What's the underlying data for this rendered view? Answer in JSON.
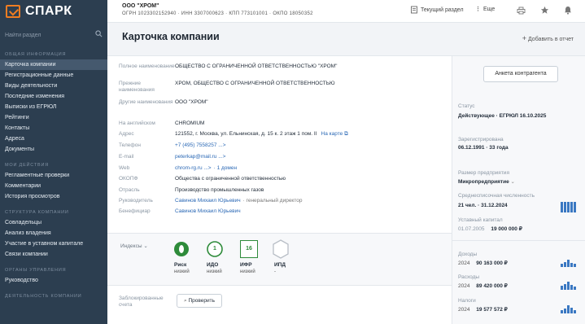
{
  "app": {
    "logo_text": "СПАРК"
  },
  "sidebar": {
    "search_placeholder": "Найти раздел",
    "sections": [
      {
        "title": "ОБЩАЯ ИНФОРМАЦИЯ",
        "items": [
          "Карточка компании",
          "Регистрационные данные",
          "Виды деятельности",
          "Последние изменения",
          "Выписки из ЕГРЮЛ",
          "Рейтинги",
          "Контакты",
          "Адреса",
          "Документы"
        ]
      },
      {
        "title": "МОИ ДЕЙСТВИЯ",
        "items": [
          "Регламентные проверки",
          "Комментарии",
          "История просмотров"
        ]
      },
      {
        "title": "СТРУКТУРА КОМПАНИИ",
        "items": [
          "Совладельцы",
          "Анализ владения",
          "Участие в уставном капитале",
          "Связи компании"
        ]
      },
      {
        "title": "ОРГАНЫ УПРАВЛЕНИЯ",
        "items": [
          "Руководство"
        ]
      },
      {
        "title": "ДЕЯТЕЛЬНОСТЬ КОМПАНИИ",
        "items": []
      }
    ]
  },
  "topbar": {
    "org_name": "ООО \"ХРОМ\"",
    "org_ids": "ОГРН 1023302152940 · ИНН 3307000623 · КПП 773101001 · ОКПО 18050352",
    "current_section": "Текущий раздел",
    "more": "Еще"
  },
  "main": {
    "title": "Карточка компании",
    "add_to_report": "Добавить в отчет",
    "fields": [
      {
        "label": "Полное наименование",
        "value": "ОБЩЕСТВО С ОГРАНИЧЕННОЙ ОТВЕТСТВЕННОСТЬЮ \"ХРОМ\""
      },
      {
        "label": "Прежние наименования",
        "value": "ХРОМ, ОБЩЕСТВО С ОГРАНИЧЕННОЙ ОТВЕТСТВЕННОСТЬЮ"
      },
      {
        "label": "Другие наименования",
        "value": "ООО \"ХРОМ\""
      },
      {
        "label": "На английском",
        "value": "CHROMIUM"
      },
      {
        "label": "Адрес",
        "value": "121552, г. Москва, ул. Ельнинская, д. 15 к. 2 этаж 1 пом. II",
        "link": "На карте"
      },
      {
        "label": "Телефон",
        "value": "+7 (495) 7558257 ...>"
      },
      {
        "label": "E-mail",
        "value": "peterkap@mail.ru ...>"
      },
      {
        "label": "Web",
        "value": "chrom-rg.ru ...>",
        "extra": "· 1 домен"
      },
      {
        "label": "ОКОПФ",
        "value": "Общества с ограниченной ответственностью"
      },
      {
        "label": "Отрасль",
        "value": "Производство промышленных газов"
      },
      {
        "label": "Руководитель",
        "value": "Савинов Михаил Юрьевич",
        "extra": "· генеральный директор"
      },
      {
        "label": "Бенефициар",
        "value": "Савинов Михаил Юрьевич"
      }
    ],
    "indices_label": "Индексы",
    "indices": [
      {
        "badge": "",
        "name": "Риск",
        "level": "низкий",
        "color": "#2e8b3a"
      },
      {
        "badge": "1",
        "name": "ИДО",
        "level": "низкий",
        "color": "#2e8b3a"
      },
      {
        "badge": "16",
        "name": "ИФР",
        "level": "низкий",
        "color": "#2e8b3a"
      },
      {
        "badge": "",
        "name": "ИПД",
        "level": "-",
        "color": "#b8bec6"
      }
    ],
    "blocked_label": "Заблокированные счета",
    "check_button": "Проверить"
  },
  "right_panel": {
    "anketa_button": "Анкета контрагента",
    "status_label": "Статус",
    "status_value": "Действующее · ЕГРЮЛ 16.10.2025",
    "registered_label": "Зарегистрирована",
    "registered_value": "06.12.1991 · 33 года",
    "size_label": "Размер предприятия",
    "size_value": "Микропредприятие",
    "employees_label": "Среднесписочная численность",
    "employees_value": "21 чел. · 31.12.2024",
    "capital_label": "Уставный капитал",
    "capital_date": "01.07.2005",
    "capital_value": "19 000 000 ₽",
    "revenue_label": "Доходы",
    "revenue_year": "2024",
    "revenue_value": "90 163 000 ₽",
    "expenses_label": "Расходы",
    "expenses_year": "2024",
    "expenses_value": "89 420 000 ₽",
    "taxes_label": "Налоги",
    "taxes_year": "2024",
    "taxes_value": "19 577 572 ₽",
    "accent_color": "#2a68b5"
  }
}
